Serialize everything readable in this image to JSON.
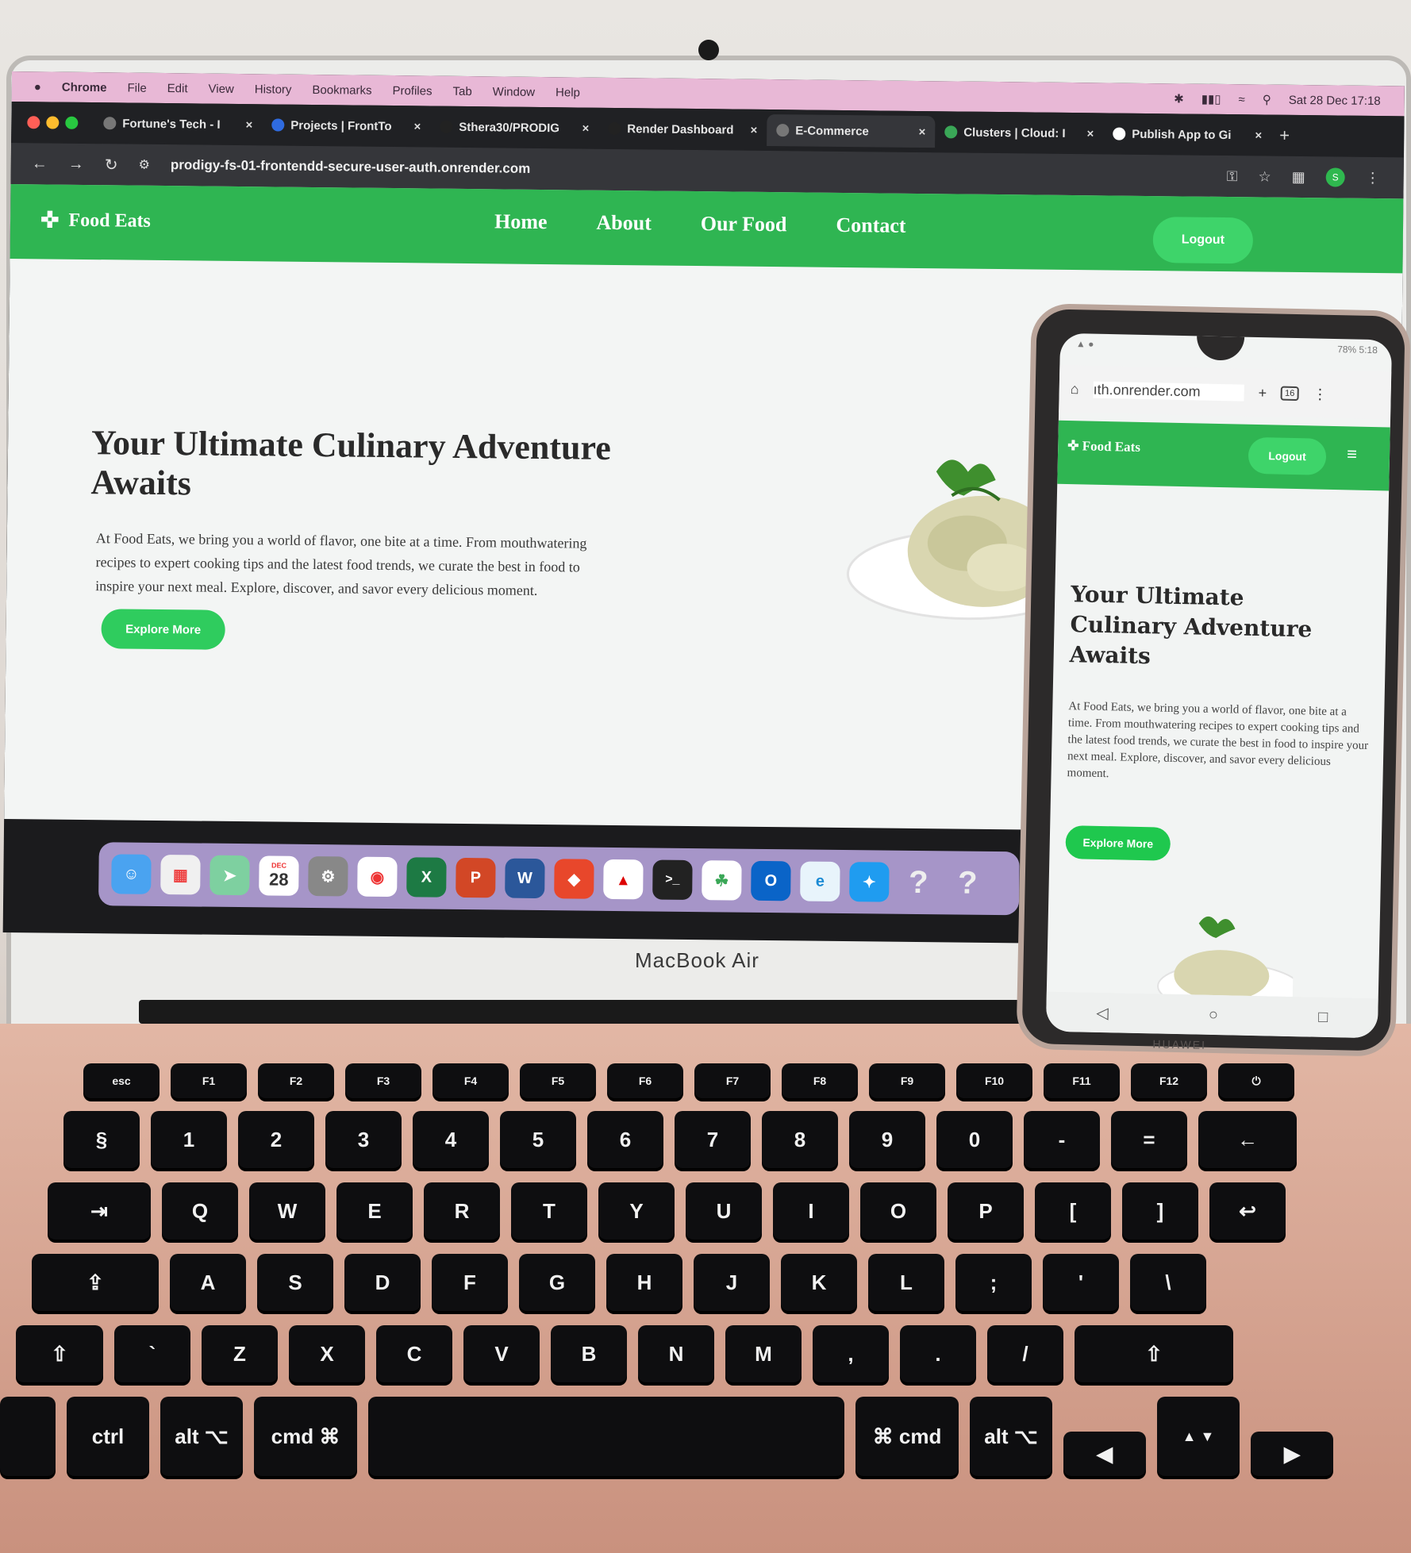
{
  "menubar": {
    "apple_icon": "apple-icon",
    "items": [
      "Chrome",
      "File",
      "Edit",
      "View",
      "History",
      "Bookmarks",
      "Profiles",
      "Tab",
      "Window",
      "Help"
    ],
    "datetime": "Sat 28 Dec  17:18"
  },
  "tabs": [
    {
      "label": "Fortune's Tech - I"
    },
    {
      "label": "Projects | FrontTo"
    },
    {
      "label": "Sthera30/PRODIG"
    },
    {
      "label": "Render Dashboard"
    },
    {
      "label": "E-Commerce"
    },
    {
      "label": "Clusters | Cloud: I"
    },
    {
      "label": "Publish App to Gi"
    }
  ],
  "address_bar": {
    "url": "prodigy-fs-01-frontendd-secure-user-auth.onrender.com",
    "profile_initial": "S"
  },
  "site": {
    "brand": "Food Eats",
    "nav": [
      "Home",
      "About",
      "Our Food",
      "Contact"
    ],
    "logout": "Logout",
    "hero_title": "Your Ultimate Culinary Adventure Awaits",
    "hero_text": "At Food Eats, we bring you a world of flavor, one bite at a time. From mouthwatering recipes to expert cooking tips and the latest food trends, we curate the best in food to inspire your next meal. Explore, discover, and savor every delicious moment.",
    "explore": "Explore More"
  },
  "dock": {
    "calendar_month": "DEC",
    "calendar_day": "28"
  },
  "laptop_label": "MacBook Air",
  "keyboard": {
    "fn_row": [
      "esc",
      "F1",
      "F2",
      "F3",
      "F4",
      "F5",
      "F6",
      "F7",
      "F8",
      "F9",
      "F10",
      "F11",
      "F12",
      "⏻"
    ],
    "row1": [
      "§",
      "1",
      "2",
      "3",
      "4",
      "5",
      "6",
      "7",
      "8",
      "9",
      "0",
      "-",
      "=",
      "←"
    ],
    "row2": [
      "⇥",
      "Q",
      "W",
      "E",
      "R",
      "T",
      "Y",
      "U",
      "I",
      "O",
      "P",
      "[",
      "]",
      "↩"
    ],
    "row3": [
      "⇪",
      "A",
      "S",
      "D",
      "F",
      "G",
      "H",
      "J",
      "K",
      "L",
      ";",
      "'",
      "\\"
    ],
    "row4": [
      "⇧",
      "`",
      "Z",
      "X",
      "C",
      "V",
      "B",
      "N",
      "M",
      ",",
      ".",
      "/",
      "⇧"
    ],
    "row5": [
      "",
      "ctrl",
      "alt ⌥",
      "cmd ⌘",
      "",
      "⌘ cmd",
      "alt ⌥",
      "◀",
      "▲ ▼",
      "▶"
    ]
  },
  "phone": {
    "status": "78%  5:18",
    "url": "ıth.onrender.com",
    "tab_count": "16",
    "brand": "Food Eats",
    "logout": "Logout",
    "hero_title": "Your Ultimate Culinary Adventure Awaits",
    "hero_text": "At Food Eats, we bring you a world of flavor, one bite at a time. From mouthwatering recipes to expert cooking tips and the latest food trends, we curate the best in food to inspire your next meal. Explore, discover, and savor every delicious moment.",
    "explore": "Explore More",
    "maker": "HUAWEI"
  },
  "colors": {
    "brand_green": "#2fb552",
    "button_green": "#3ed46a"
  }
}
